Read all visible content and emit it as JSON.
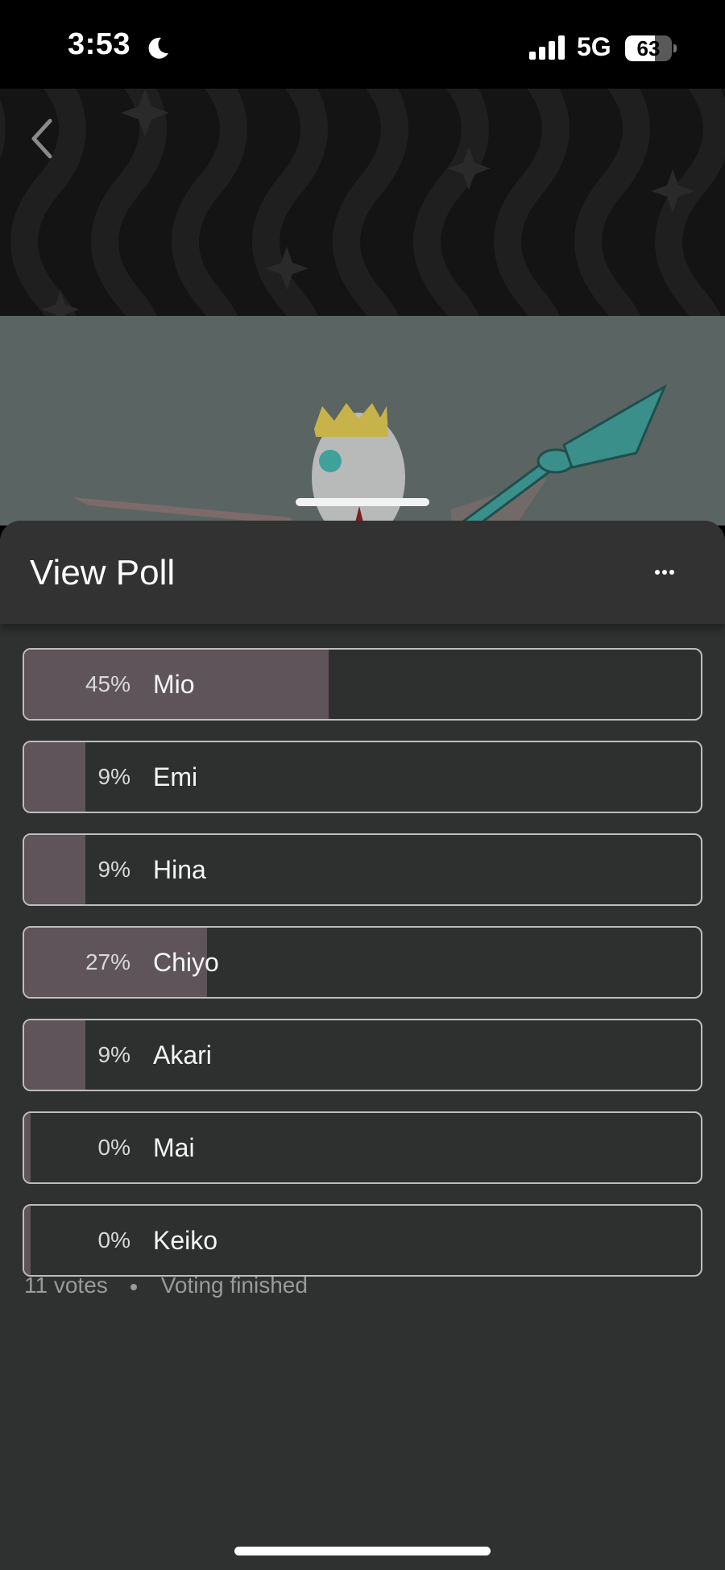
{
  "status_bar": {
    "time": "3:53",
    "network": "5G",
    "battery_level": "63",
    "battery_fraction": 0.63
  },
  "sheet": {
    "title": "View Poll"
  },
  "poll": {
    "options": [
      {
        "label": "Mio",
        "percent_text": "45%",
        "percent": 45
      },
      {
        "label": "Emi",
        "percent_text": "9%",
        "percent": 9
      },
      {
        "label": "Hina",
        "percent_text": "9%",
        "percent": 9
      },
      {
        "label": "Chiyo",
        "percent_text": "27%",
        "percent": 27
      },
      {
        "label": "Akari",
        "percent_text": "9%",
        "percent": 9
      },
      {
        "label": "Mai",
        "percent_text": "0%",
        "percent": 0
      },
      {
        "label": "Keiko",
        "percent_text": "0%",
        "percent": 0
      }
    ],
    "votes": "11 votes",
    "status": "Voting finished"
  },
  "icons": {
    "back": "chevron-left-icon",
    "more": "more-horizontal-icon",
    "moon": "moon-icon",
    "signal": "cellular-signal-icon"
  },
  "colors": {
    "sheet_background": "#2f3030",
    "result_fill": "#5e5459",
    "option_border": "#bdbdbd"
  }
}
